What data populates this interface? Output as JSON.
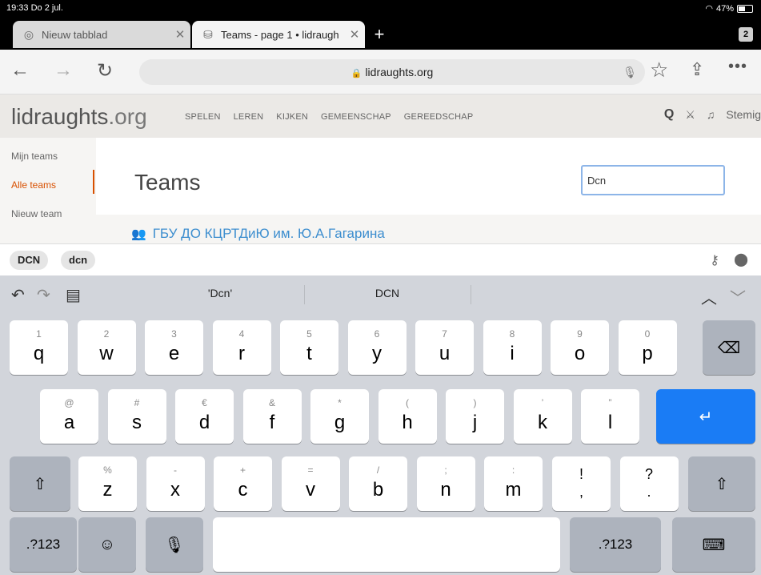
{
  "status": {
    "time": "19:33  Do 2 jul.",
    "wifi": "wifi-icon",
    "battery": "47%",
    "battery_level": 0.47
  },
  "tabs": [
    {
      "title": "Nieuw tabblad",
      "favicon": "chrome-icon"
    },
    {
      "title": "Teams - page 1 • lidraugh",
      "favicon": "database-icon"
    }
  ],
  "tab_count": "2",
  "toolbar": {
    "url": "lidraughts.org"
  },
  "site": {
    "logo": "lidraughts",
    "logo_tld": ".org",
    "nav": [
      "SPELEN",
      "LEREN",
      "KIJKEN",
      "GEMEENSCHAP",
      "GEREEDSCHAP"
    ],
    "user": "Stemig"
  },
  "sidebar": {
    "items": [
      "Mijn teams",
      "Alle teams",
      "Nieuw team"
    ]
  },
  "page": {
    "title": "Teams",
    "search_value": "Dcn",
    "team": "ГБУ ДО КЦРТДиЮ им. Ю.А.Гагарина"
  },
  "suggestions": [
    "DCN",
    "dcn"
  ],
  "keyboard": {
    "predictions": [
      "'Dcn'",
      "DCN"
    ],
    "row1": [
      [
        "1",
        "q"
      ],
      [
        "2",
        "w"
      ],
      [
        "3",
        "e"
      ],
      [
        "4",
        "r"
      ],
      [
        "5",
        "t"
      ],
      [
        "6",
        "y"
      ],
      [
        "7",
        "u"
      ],
      [
        "8",
        "i"
      ],
      [
        "9",
        "o"
      ],
      [
        "0",
        "p"
      ]
    ],
    "row2": [
      [
        "@",
        "a"
      ],
      [
        "#",
        "s"
      ],
      [
        "€",
        "d"
      ],
      [
        "&",
        "f"
      ],
      [
        "*",
        "g"
      ],
      [
        "(",
        "h"
      ],
      [
        ")",
        "j"
      ],
      [
        "’",
        "k"
      ],
      [
        "”",
        "l"
      ]
    ],
    "row3": [
      [
        "%",
        "z"
      ],
      [
        "-",
        "x"
      ],
      [
        "+",
        "c"
      ],
      [
        "=",
        "v"
      ],
      [
        "/",
        "b"
      ],
      [
        ";",
        "n"
      ],
      [
        ":",
        "m"
      ]
    ],
    "row3_punct": [
      [
        "!",
        ","
      ],
      [
        "?",
        "."
      ]
    ],
    "numbers_label": ".?123"
  }
}
